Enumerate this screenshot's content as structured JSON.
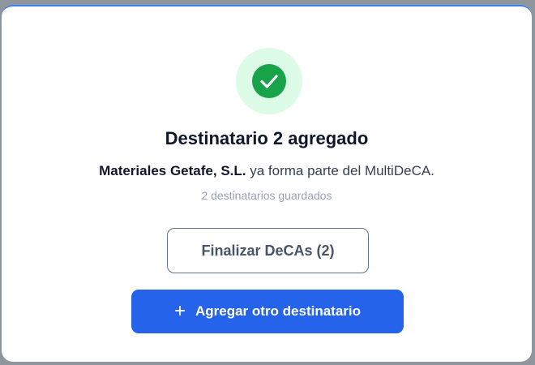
{
  "dialog": {
    "title": "Destinatario 2 agregado",
    "company": "Materiales Getafe, S.L.",
    "message_suffix": " ya forma parte del MultiDeCA.",
    "saved_count_text": "2 destinatarios guardados",
    "success_icon": "check-circle-icon"
  },
  "actions": {
    "finish_label": "Finalizar DeCAs (2)",
    "add_label": "Agregar otro destinatario",
    "add_icon": "+"
  },
  "colors": {
    "primary": "#2563eb",
    "success": "#16a34a",
    "success_bg": "#dcfce7"
  }
}
